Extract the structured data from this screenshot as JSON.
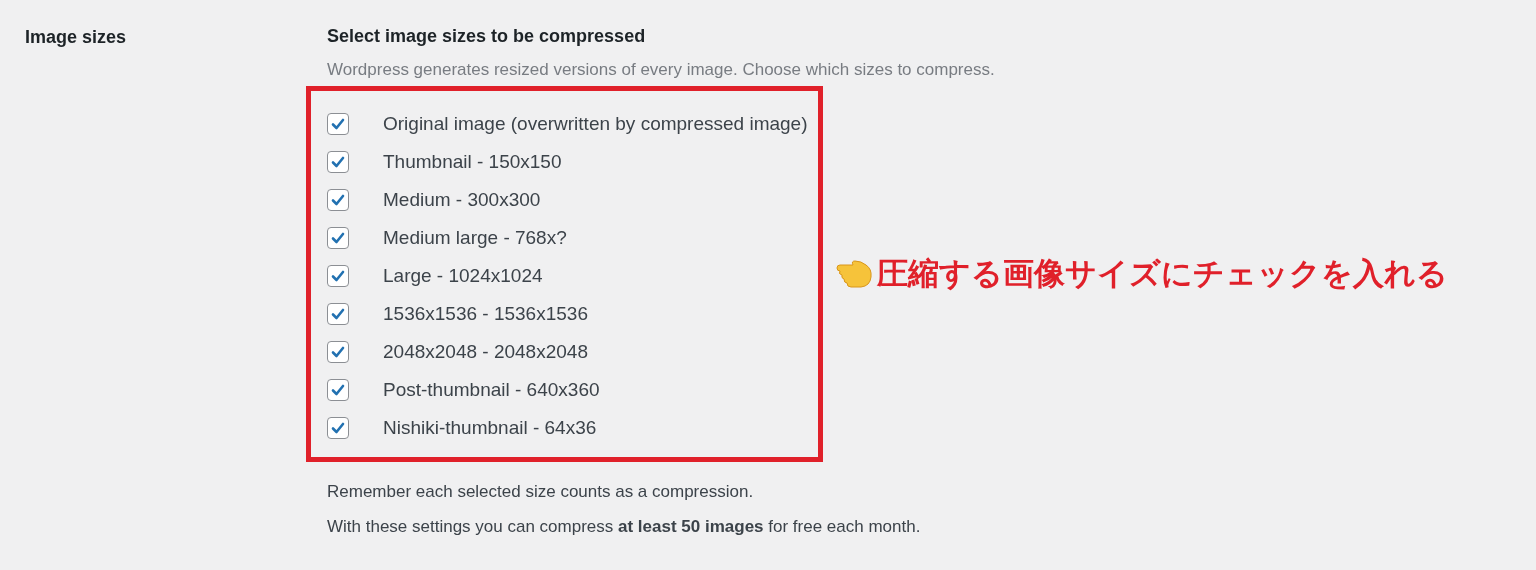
{
  "label": "Image sizes",
  "heading": "Select image sizes to be compressed",
  "description": "Wordpress generates resized versions of every image. Choose which sizes to compress.",
  "sizes": [
    {
      "label": "Original image (overwritten by compressed image)",
      "checked": true
    },
    {
      "label": "Thumbnail - 150x150",
      "checked": true
    },
    {
      "label": "Medium - 300x300",
      "checked": true
    },
    {
      "label": "Medium large - 768x?",
      "checked": true
    },
    {
      "label": "Large - 1024x1024",
      "checked": true
    },
    {
      "label": "1536x1536 - 1536x1536",
      "checked": true
    },
    {
      "label": "2048x2048 - 2048x2048",
      "checked": true
    },
    {
      "label": "Post-thumbnail - 640x360",
      "checked": true
    },
    {
      "label": "Nishiki-thumbnail - 64x36",
      "checked": true
    }
  ],
  "annotation": "圧縮する画像サイズにチェックを入れる",
  "notes": [
    "Remember each selected size counts as a compression.",
    "With these settings you can compress **at least 50 images** for free each month."
  ]
}
